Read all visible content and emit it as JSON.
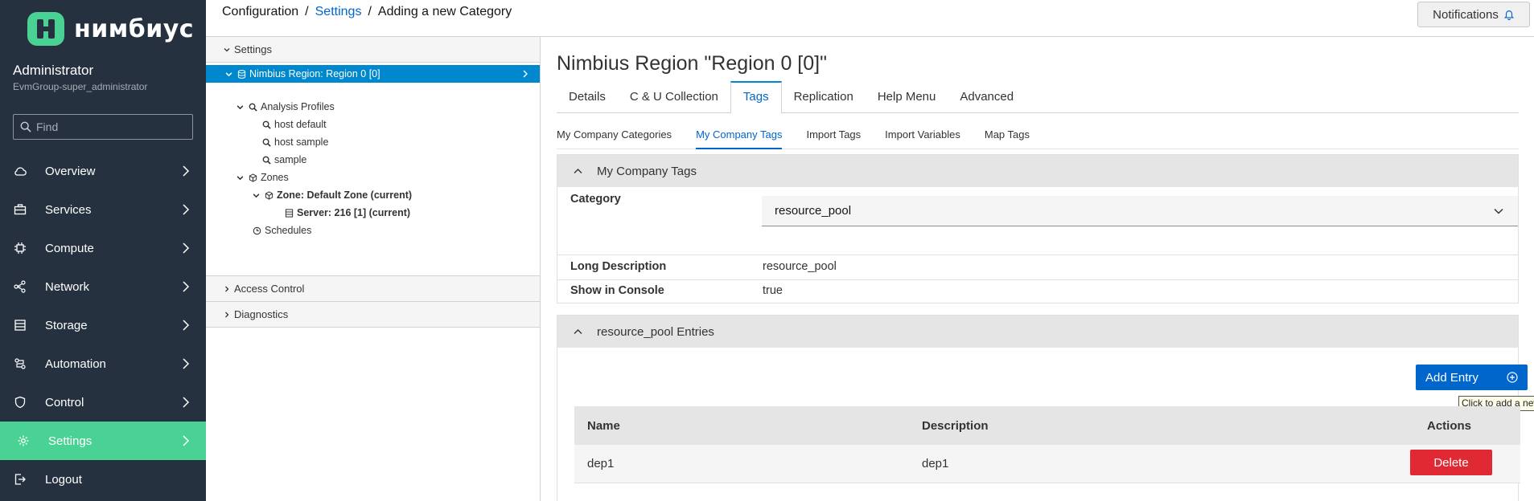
{
  "brand": {
    "name": "нимбиус",
    "accent": "#4ad295",
    "nav_bg": "#25313f"
  },
  "user": {
    "name": "Administrator",
    "group": "EvmGroup-super_administrator"
  },
  "search": {
    "placeholder": "Find"
  },
  "nav": {
    "items": [
      {
        "label": "Overview",
        "icon": "cloud-icon"
      },
      {
        "label": "Services",
        "icon": "briefcase-icon"
      },
      {
        "label": "Compute",
        "icon": "cpu-icon"
      },
      {
        "label": "Network",
        "icon": "network-icon"
      },
      {
        "label": "Storage",
        "icon": "storage-icon"
      },
      {
        "label": "Automation",
        "icon": "automation-icon"
      },
      {
        "label": "Control",
        "icon": "shield-icon"
      },
      {
        "label": "Settings",
        "icon": "gear-icon",
        "active": true
      },
      {
        "label": "Logout",
        "icon": "logout-icon"
      }
    ]
  },
  "breadcrumb": {
    "root": "Configuration",
    "sep1": "/",
    "middle": "Settings",
    "sep2": "/",
    "current": "Adding a new Category"
  },
  "notifications": {
    "label": "Notifications"
  },
  "tree": {
    "settings_header": "Settings",
    "access_control": "Access Control",
    "diagnostics": "Diagnostics",
    "nodes": {
      "region": "Nimbius Region: Region 0 [0]",
      "analysis_profiles": "Analysis Profiles",
      "host_default": "host default",
      "host_sample": "host sample",
      "sample": "sample",
      "zones": "Zones",
      "zone_default": "Zone: Default Zone (current)",
      "server": "Server: 216 [1] (current)",
      "schedules": "Schedules"
    }
  },
  "main": {
    "title": "Nimbius Region \"Region 0 [0]\"",
    "tabs": [
      "Details",
      "C & U Collection",
      "Tags",
      "Replication",
      "Help Menu",
      "Advanced"
    ],
    "active_tab": "Tags",
    "subtabs": [
      "My Company Categories",
      "My Company Tags",
      "Import Tags",
      "Import Variables",
      "Map Tags"
    ],
    "active_subtab": "My Company Tags",
    "company_tags_panel": {
      "title": "My Company Tags",
      "category_label": "Category",
      "category_value": "resource_pool",
      "long_desc_label": "Long Description",
      "long_desc_value": "resource_pool",
      "show_console_label": "Show in Console",
      "show_console_value": "true"
    },
    "entries_panel": {
      "title": "resource_pool Entries",
      "add_button": "Add Entry",
      "tooltip": "Click to add a new ent",
      "columns": [
        "Name",
        "Description",
        "Actions"
      ],
      "rows": [
        {
          "name": "dep1",
          "description": "dep1",
          "action": "Delete"
        }
      ]
    }
  }
}
